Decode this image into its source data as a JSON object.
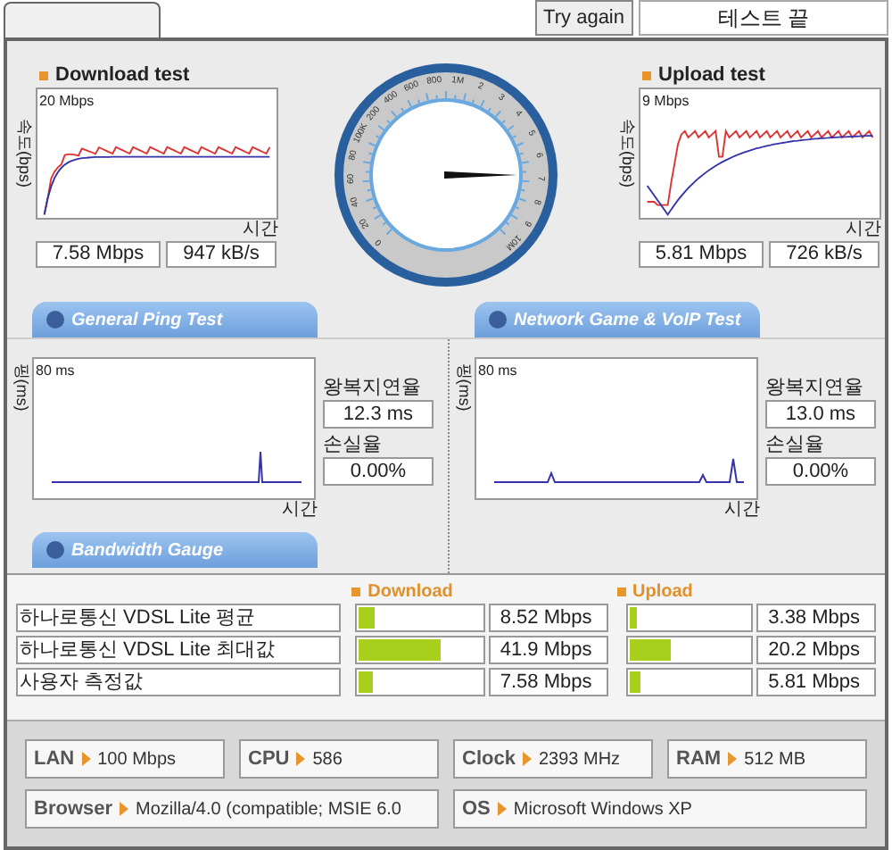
{
  "top_bar": {
    "button": "Try again",
    "status": "테스트 끝"
  },
  "speed_tests": [
    {
      "title": "Download test",
      "axis_label": "속도(bps)",
      "scale": "20 Mbps",
      "time_label": "시간",
      "readings": [
        "7.58 Mbps",
        "947 kB/s"
      ]
    },
    {
      "title": "Upload test",
      "axis_label": "속도(bps)",
      "scale": "9 Mbps",
      "time_label": "시간",
      "readings": [
        "5.81 Mbps",
        "726 kB/s"
      ]
    }
  ],
  "gauge": {
    "labels": [
      "0",
      "20",
      "40",
      "60",
      "80",
      "100K",
      "200",
      "400",
      "600",
      "800",
      "1M",
      "2",
      "3",
      "4",
      "5",
      "6",
      "7",
      "8",
      "9",
      "10M"
    ]
  },
  "ping_tests": [
    {
      "tab": "General Ping Test",
      "axis_label": "핑(ms)",
      "scale": "80 ms",
      "time_label": "시간",
      "latency_label": "왕복지연율",
      "latency": "12.3 ms",
      "loss_label": "손실율",
      "loss": "0.00%"
    },
    {
      "tab": "Network Game & VoIP Test",
      "axis_label": "핑(ms)",
      "scale": "80 ms",
      "time_label": "시간",
      "latency_label": "왕복지연율",
      "latency": "13.0 ms",
      "loss_label": "손실율",
      "loss": "0.00%"
    }
  ],
  "bandwidth": {
    "tab": "Bandwidth Gauge",
    "columns": [
      "Download",
      "Upload"
    ],
    "rows": [
      {
        "name": "하나로통신 VDSL Lite 평균",
        "download": {
          "level": 0.14,
          "value": "8.52 Mbps"
        },
        "upload": {
          "level": 0.06,
          "value": "3.38 Mbps"
        }
      },
      {
        "name": "하나로통신 VDSL Lite 최대값",
        "download": {
          "level": 0.68,
          "value": "41.9 Mbps"
        },
        "upload": {
          "level": 0.35,
          "value": "20.2 Mbps"
        }
      },
      {
        "name": "사용자 측정값",
        "download": {
          "level": 0.12,
          "value": "7.58 Mbps"
        },
        "upload": {
          "level": 0.09,
          "value": "5.81 Mbps"
        }
      }
    ]
  },
  "system_info": [
    {
      "label": "LAN",
      "value": "100 Mbps"
    },
    {
      "label": "CPU",
      "value": "586"
    },
    {
      "label": "Clock",
      "value": "2393 MHz"
    },
    {
      "label": "RAM",
      "value": "512 MB"
    },
    {
      "label": "Browser",
      "value": "Mozilla/4.0 (compatible; MSIE 6.0"
    },
    {
      "label": "OS",
      "value": "Microsoft Windows XP"
    }
  ]
}
